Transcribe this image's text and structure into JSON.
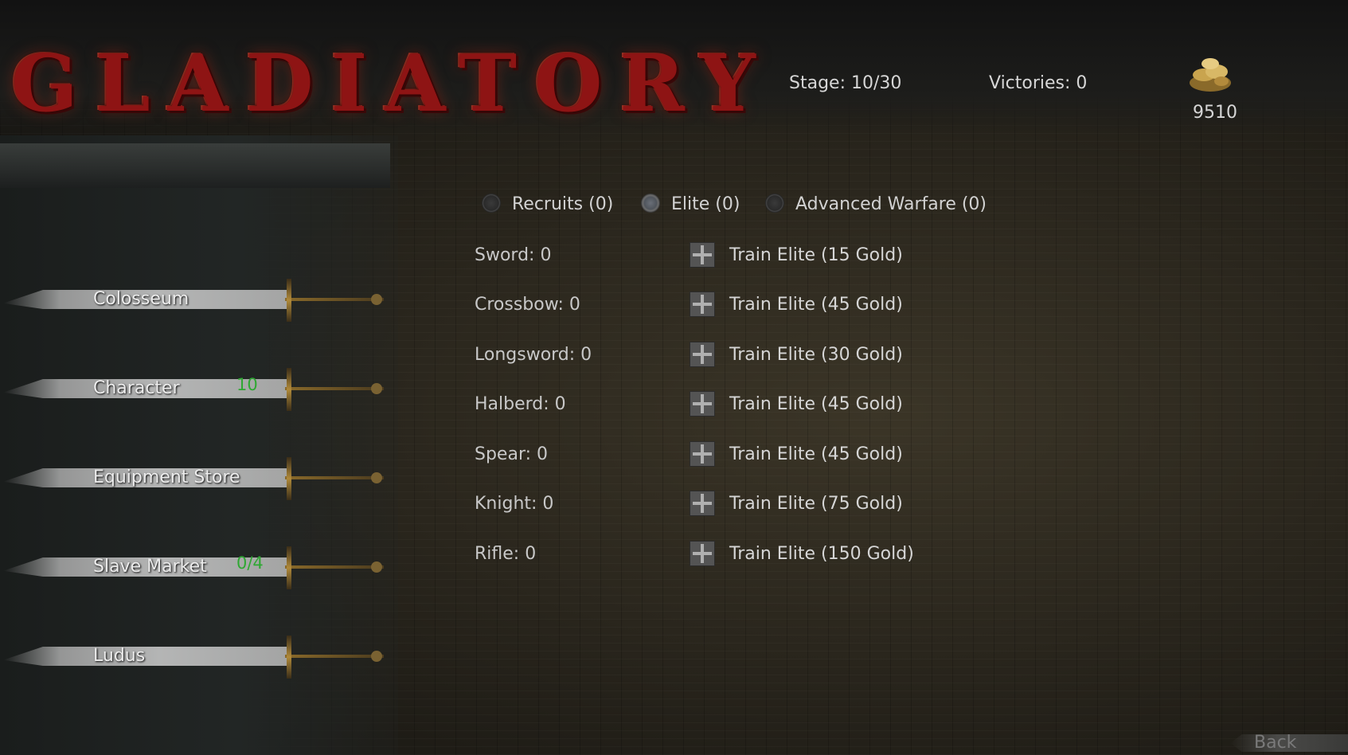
{
  "header": {
    "logo_text": "GLADIATORY",
    "stage": "Stage: 10/30",
    "victories": "Victories: 0",
    "gold": "9510",
    "gold_icon": "gold-pile-icon"
  },
  "menu": [
    {
      "label": "Colosseum",
      "badge": ""
    },
    {
      "label": "Character",
      "badge": "10"
    },
    {
      "label": "Equipment Store",
      "badge": ""
    },
    {
      "label": "Slave Market",
      "badge": "0/4"
    },
    {
      "label": "Ludus",
      "badge": ""
    }
  ],
  "tabs": [
    {
      "label": "Recruits (0)",
      "selected": false
    },
    {
      "label": "Elite (0)",
      "selected": true
    },
    {
      "label": "Advanced Warfare (0)",
      "selected": false
    }
  ],
  "units": [
    {
      "label": "Sword: 0",
      "action": "Train Elite (15 Gold)"
    },
    {
      "label": "Crossbow: 0",
      "action": "Train Elite (45 Gold)"
    },
    {
      "label": "Longsword: 0",
      "action": "Train Elite (30 Gold)"
    },
    {
      "label": "Halberd: 0",
      "action": "Train Elite (45 Gold)"
    },
    {
      "label": "Spear: 0",
      "action": "Train Elite (45 Gold)"
    },
    {
      "label": "Knight: 0",
      "action": "Train Elite (75 Gold)"
    },
    {
      "label": "Rifle: 0",
      "action": "Train Elite (150 Gold)"
    }
  ],
  "footer": {
    "back_label": "Back"
  },
  "colors": {
    "logo_red": "#8e1414",
    "badge_green": "#2fa833"
  }
}
